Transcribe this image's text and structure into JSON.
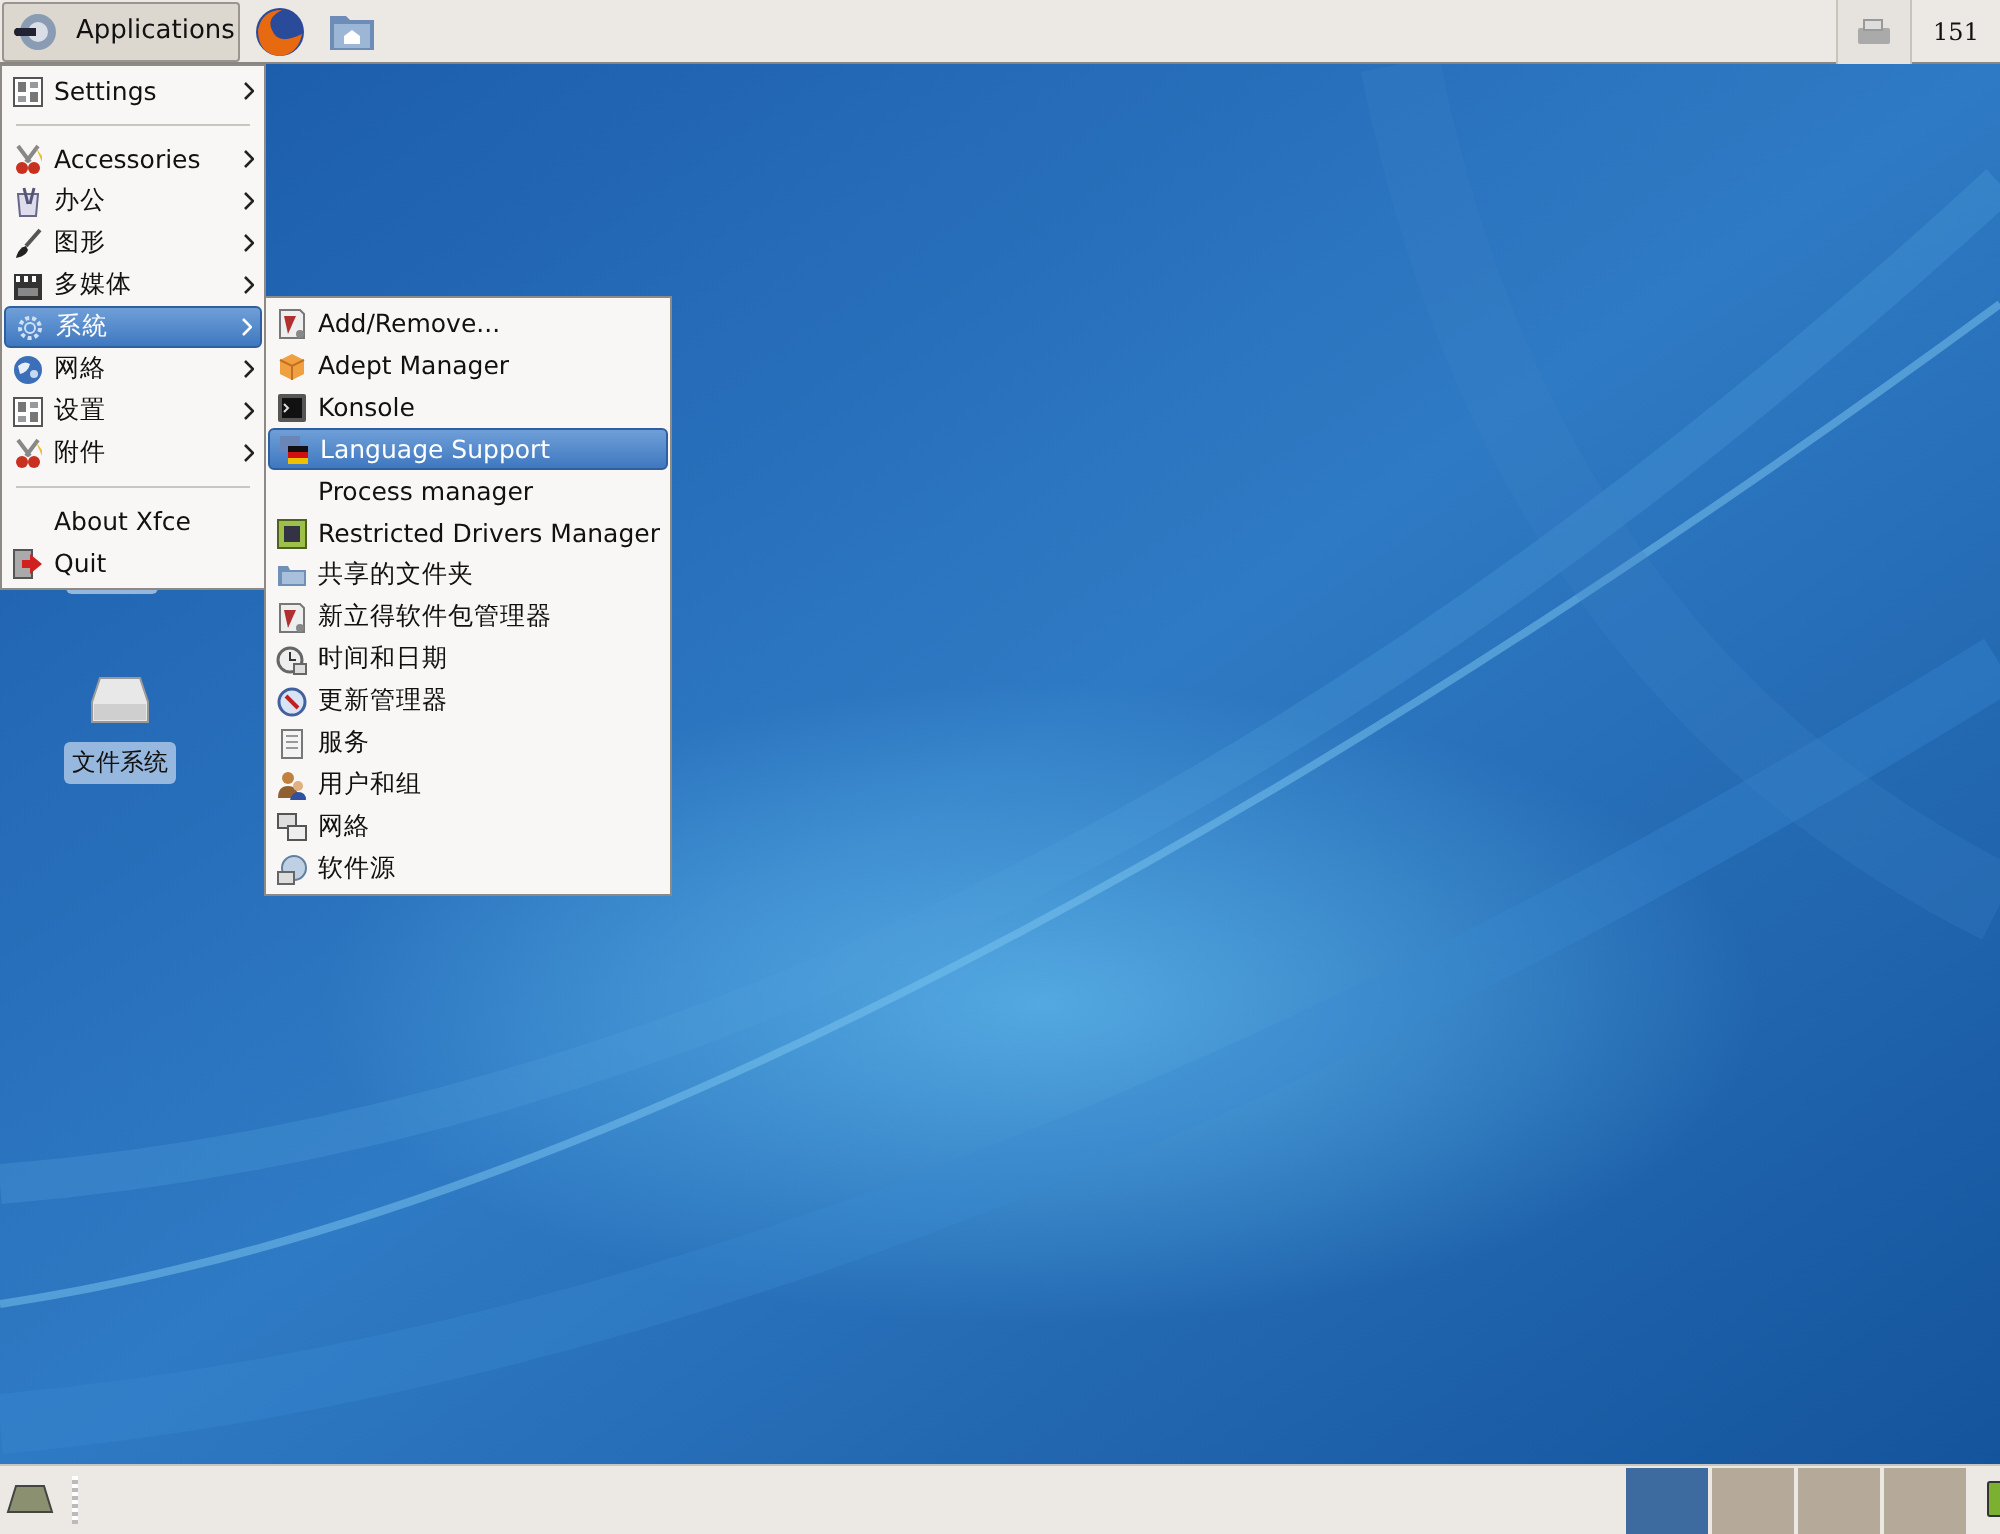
{
  "top_panel": {
    "app_button": "Applications",
    "clock": "151"
  },
  "desktop_icons": [
    {
      "label": "文件系统"
    }
  ],
  "menu": {
    "groups": [
      [
        {
          "label": "Settings",
          "has_submenu": true,
          "selected": false
        }
      ],
      [
        {
          "label": "Accessories",
          "has_submenu": true,
          "selected": false
        },
        {
          "label": "办公",
          "has_submenu": true,
          "selected": false
        },
        {
          "label": "图形",
          "has_submenu": true,
          "selected": false
        },
        {
          "label": "多媒体",
          "has_submenu": true,
          "selected": false
        },
        {
          "label": "系統",
          "has_submenu": true,
          "selected": true
        },
        {
          "label": "网絡",
          "has_submenu": true,
          "selected": false
        },
        {
          "label": "设置",
          "has_submenu": true,
          "selected": false
        },
        {
          "label": "附件",
          "has_submenu": true,
          "selected": false
        }
      ],
      [
        {
          "label": "About Xfce",
          "has_submenu": false,
          "selected": false
        },
        {
          "label": "Quit",
          "has_submenu": false,
          "selected": false
        }
      ]
    ]
  },
  "submenu": {
    "items": [
      {
        "label": "Add/Remove...",
        "selected": false
      },
      {
        "label": "Adept Manager",
        "selected": false
      },
      {
        "label": "Konsole",
        "selected": false
      },
      {
        "label": "Language Support",
        "selected": true
      },
      {
        "label": "Process manager",
        "selected": false
      },
      {
        "label": "Restricted Drivers Manager",
        "selected": false
      },
      {
        "label": "共享的文件夹",
        "selected": false
      },
      {
        "label": "新立得软件包管理器",
        "selected": false
      },
      {
        "label": "时间和日期",
        "selected": false
      },
      {
        "label": "更新管理器",
        "selected": false
      },
      {
        "label": "服务",
        "selected": false
      },
      {
        "label": "用户和组",
        "selected": false
      },
      {
        "label": "网絡",
        "selected": false
      },
      {
        "label": "软件源",
        "selected": false
      }
    ]
  },
  "workspaces": [
    {
      "selected": true
    },
    {
      "selected": false
    },
    {
      "selected": false
    },
    {
      "selected": false
    }
  ]
}
